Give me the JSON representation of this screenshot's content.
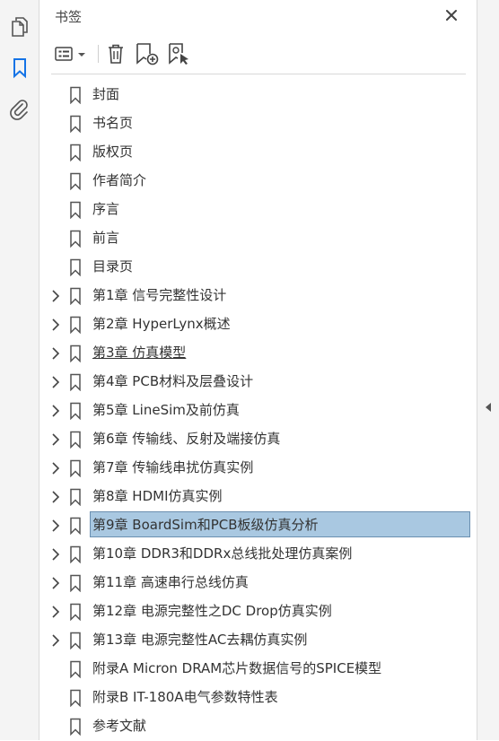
{
  "panel": {
    "title": "书签"
  },
  "icons": {
    "left_rail": [
      "pages-icon",
      "bookmark-icon",
      "attachment-icon"
    ],
    "toolbar": [
      "options-icon",
      "delete-icon",
      "new-bookmark-icon",
      "bookmark-from-selection-icon"
    ],
    "close": "close-icon"
  },
  "colors": {
    "selection": "#a9c8e1",
    "accent": "#1473e6"
  },
  "bookmarks": [
    {
      "label": "封面",
      "expandable": false
    },
    {
      "label": "书名页",
      "expandable": false
    },
    {
      "label": "版权页",
      "expandable": false
    },
    {
      "label": "作者简介",
      "expandable": false
    },
    {
      "label": "序言",
      "expandable": false
    },
    {
      "label": "前言",
      "expandable": false
    },
    {
      "label": "目录页",
      "expandable": false
    },
    {
      "label": "第1章  信号完整性设计",
      "expandable": true
    },
    {
      "label": "第2章  HyperLynx概述",
      "expandable": true
    },
    {
      "label": "第3章  仿真模型",
      "expandable": true,
      "underlined": true
    },
    {
      "label": "第4章  PCB材料及层叠设计",
      "expandable": true
    },
    {
      "label": "第5章  LineSim及前仿真",
      "expandable": true
    },
    {
      "label": "第6章  传输线、反射及端接仿真",
      "expandable": true
    },
    {
      "label": "第7章  传输线串扰仿真实例",
      "expandable": true
    },
    {
      "label": "第8章  HDMI仿真实例",
      "expandable": true
    },
    {
      "label": "第9章  BoardSim和PCB板级仿真分析",
      "expandable": true,
      "selected": true
    },
    {
      "label": "第10章  DDR3和DDRx总线批处理仿真案例",
      "expandable": true
    },
    {
      "label": "第11章  高速串行总线仿真",
      "expandable": true
    },
    {
      "label": "第12章  电源完整性之DC Drop仿真实例",
      "expandable": true
    },
    {
      "label": "第13章  电源完整性AC去耦仿真实例",
      "expandable": true
    },
    {
      "label": "附录A  Micron DRAM芯片数据信号的SPICE模型",
      "expandable": false
    },
    {
      "label": "附录B  IT-180A电气参数特性表",
      "expandable": false
    },
    {
      "label": "参考文献",
      "expandable": false
    }
  ]
}
